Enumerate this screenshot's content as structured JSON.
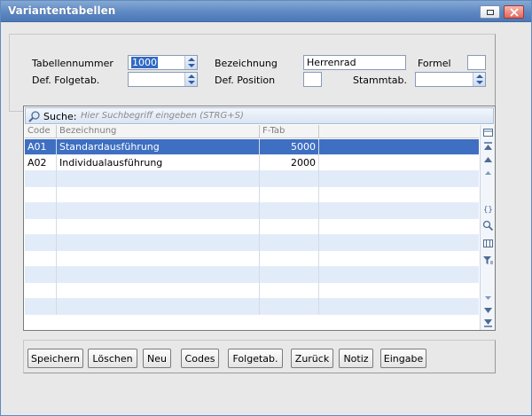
{
  "window": {
    "title": "Variantentabellen"
  },
  "form": {
    "tabellennummer_label": "Tabellennummer",
    "tabellennummer_value": "1000",
    "bezeichnung_label": "Bezeichnung",
    "bezeichnung_value": "Herrenrad",
    "formel_label": "Formel",
    "formel_value": "",
    "def_folgetab_label": "Def. Folgetab.",
    "def_folgetab_value": "",
    "def_position_label": "Def. Position",
    "def_position_value": "",
    "stammtab_label": "Stammtab.",
    "stammtab_value": ""
  },
  "search": {
    "label": "Suche:",
    "placeholder": "Hier Suchbegriff eingeben (STRG+S)"
  },
  "table": {
    "columns": [
      "Code",
      "Bezeichnung",
      "F-Tab"
    ],
    "rows": [
      {
        "code": "A01",
        "bezeichnung": "Standardausführung",
        "ftab": "5000"
      },
      {
        "code": "A02",
        "bezeichnung": "Individualausführung",
        "ftab": "2000"
      }
    ]
  },
  "buttons": {
    "speichern": "Speichern",
    "loeschen": "Löschen",
    "neu": "Neu",
    "codes": "Codes",
    "folgetab": "Folgetab.",
    "zurueck": "Zurück",
    "notiz": "Notiz",
    "eingabe": "Eingabe"
  },
  "colors": {
    "titlebar": "#5e88c3",
    "selection": "#3e6fc2",
    "alt_row": "#e2ecf8"
  },
  "icons": [
    "restore-icon",
    "close-icon",
    "spin-icon",
    "search-icon",
    "scroll-top-icon",
    "scroll-up-icon",
    "scroll-down-icon",
    "scroll-bottom-icon",
    "columns-icon",
    "braces-icon",
    "zoom-icon",
    "filter-icon"
  ]
}
